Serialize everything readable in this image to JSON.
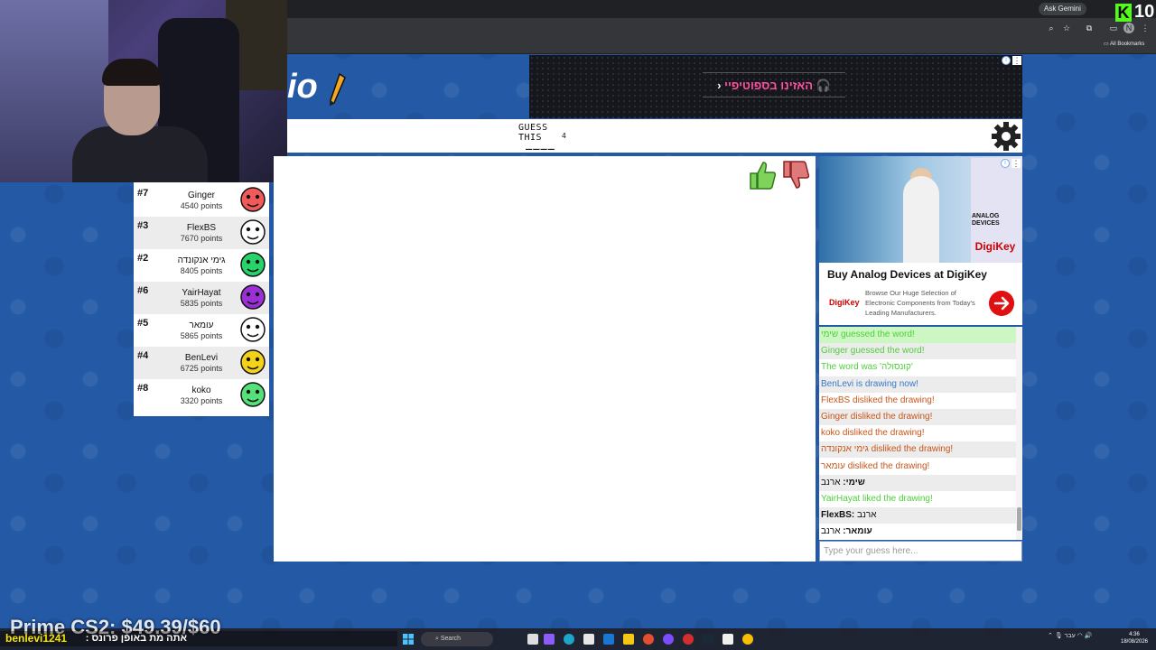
{
  "browser": {
    "gemini_label": "Ask Gemini",
    "all_bookmarks": "All Bookmarks",
    "kick_number": "10"
  },
  "game": {
    "logo_text": "io",
    "guess_label": "GUESS THIS",
    "letter_count": "4",
    "word_blanks": "____"
  },
  "top_ad": {
    "cta_text": "האזינו בספוטיפיי"
  },
  "players": [
    {
      "rank": "#7",
      "name": "Ginger",
      "points": "4540 points",
      "color": "#f25a5a"
    },
    {
      "rank": "#3",
      "name": "FlexBS",
      "points": "7670 points",
      "color": "#ffffff"
    },
    {
      "rank": "#2",
      "name": "גימי אנקונדה",
      "points": "8405 points",
      "color": "#27d46a"
    },
    {
      "rank": "#6",
      "name": "YairHayat",
      "points": "5835 points",
      "color": "#9b2fd6"
    },
    {
      "rank": "#5",
      "name": "עומאר",
      "points": "5865 points",
      "color": "#ffffff"
    },
    {
      "rank": "#4",
      "name": "BenLevi",
      "points": "6725 points",
      "color": "#f5d21a"
    },
    {
      "rank": "#8",
      "name": "koko",
      "points": "3320 points",
      "color": "#55e07a"
    }
  ],
  "right_ad": {
    "brand1": "ANALOG DEVICES",
    "brand2": "DigiKey",
    "title": "Buy Analog Devices at DigiKey",
    "description": "Browse Our Huge Selection of Electronic Components from Today's Leading Manufacturers."
  },
  "chat": {
    "messages": [
      {
        "who": "",
        "text": "שימי guessed the word!",
        "type": "green hl"
      },
      {
        "who": "",
        "text": "Ginger guessed the word!",
        "type": "green"
      },
      {
        "who": "",
        "text": "The word was 'קונסולה'",
        "type": "green"
      },
      {
        "who": "",
        "text": "BenLevi is drawing now!",
        "type": "blue"
      },
      {
        "who": "",
        "text": "FlexBS disliked the drawing!",
        "type": "red"
      },
      {
        "who": "",
        "text": "Ginger disliked the drawing!",
        "type": "red"
      },
      {
        "who": "",
        "text": "koko disliked the drawing!",
        "type": "red"
      },
      {
        "who": "",
        "text": "גימי אנקונדה disliked the drawing!",
        "type": "red"
      },
      {
        "who": "",
        "text": "עומאר disliked the drawing!",
        "type": "red"
      },
      {
        "who": "שימי:",
        "text": " ארנב",
        "type": "dark"
      },
      {
        "who": "",
        "text": "YairHayat liked the drawing!",
        "type": "green"
      },
      {
        "who": "FlexBS:",
        "text": " ארנב",
        "type": "dark"
      },
      {
        "who": "עומאר:",
        "text": " ארנב",
        "type": "dark"
      }
    ],
    "input_placeholder": "Type your guess here..."
  },
  "overlay": {
    "prime": "Prime CS2: $49.39/$60",
    "ticker_user": "benlevi1241",
    "ticker_msg": "אתה מת באופן פרונס :"
  },
  "taskbar": {
    "search": "Search",
    "clock_time": "4:36",
    "clock_date": "18/08/2026",
    "lang": "עבר"
  }
}
